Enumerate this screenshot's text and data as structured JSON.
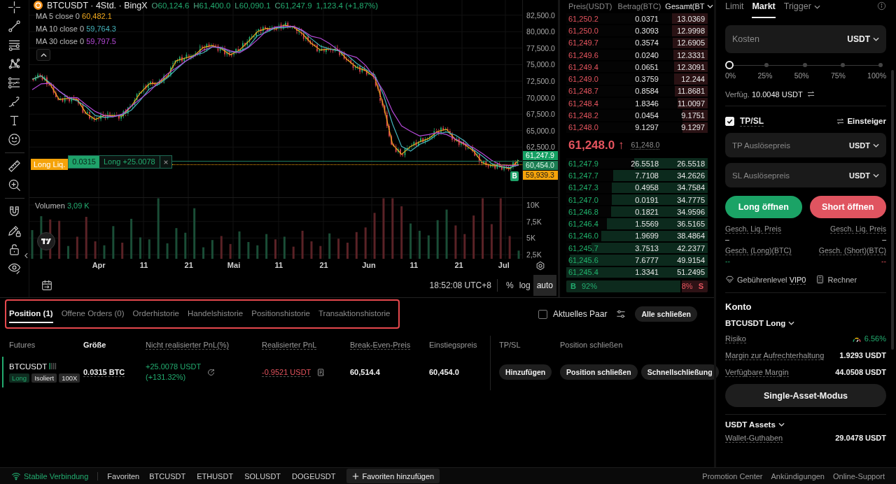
{
  "chart": {
    "title": "BTCUSDT · 4Std. · BingX",
    "ohlc": [
      {
        "label": "O",
        "value": "60,124.6"
      },
      {
        "label": "H",
        "value": "61,400.0"
      },
      {
        "label": "L",
        "value": "60,090.1"
      },
      {
        "label": "C",
        "value": "61,247.9"
      }
    ],
    "change": "1,123.4 (+1,87%)",
    "indicators": [
      {
        "label": "MA 5 close 0",
        "value": "60,482.1"
      },
      {
        "label": "MA 10 close 0",
        "value": "59,764.3"
      },
      {
        "label": "MA 30 close 0",
        "value": "59,797.5"
      }
    ],
    "chart_data": {
      "type": "line",
      "grid": true,
      "ylim": [
        54900,
        84800
      ],
      "yticks": [
        {
          "value": 62500,
          "label": "62,500.0"
        },
        {
          "value": 65000,
          "label": "65,000.0"
        },
        {
          "value": 67500,
          "label": "67,500.0"
        },
        {
          "value": 70000,
          "label": "70,000.0"
        },
        {
          "value": 72500,
          "label": "72,500.0"
        },
        {
          "value": 75000,
          "label": "75,000.0"
        },
        {
          "value": 77500,
          "label": "77,500.0"
        },
        {
          "value": 80000,
          "label": "80,000.0"
        },
        {
          "value": 82500,
          "label": "82,500.0"
        }
      ],
      "series": [
        {
          "color": "#f0a81c",
          "values": [
            72800,
            73300,
            72000,
            69700,
            69900,
            69700,
            67600,
            66700,
            67300,
            67300,
            67200,
            68700,
            70700,
            72100,
            72200,
            73200,
            75600,
            76000,
            76400,
            77600,
            77900,
            77400,
            76500,
            77200,
            78500,
            80000,
            80500,
            80400,
            81000,
            80700,
            79700,
            78200,
            77200,
            77400,
            77200,
            75700,
            74600,
            74100,
            73100,
            68800,
            62900,
            61400,
            62600,
            63300,
            63800,
            64900,
            65200,
            63600,
            62900,
            61900,
            60100,
            59700,
            59600,
            59200,
            60500
          ]
        },
        {
          "color": "#45b5bd",
          "values": [
            72800,
            73300,
            72200,
            71000,
            70000,
            69500,
            68600,
            67300,
            67000,
            67100,
            67400,
            68100,
            69600,
            71300,
            72000,
            73000,
            74300,
            75500,
            76400,
            76800,
            77700,
            77500,
            76900,
            77000,
            77700,
            79400,
            79900,
            80600,
            80600,
            80800,
            80100,
            78900,
            77800,
            77400,
            77100,
            76400,
            75200,
            74300,
            73500,
            70400,
            66000,
            62600,
            61900,
            62900,
            63500,
            64500,
            64800,
            64300,
            63400,
            62100,
            61100,
            60000,
            59500,
            59400,
            59800
          ]
        },
        {
          "color": "#b549d8",
          "values": [
            71200,
            72100,
            72200,
            71000,
            70000,
            70000,
            68900,
            67900,
            67300,
            67100,
            67500,
            68700,
            69800,
            70900,
            72300,
            73600,
            74500,
            75500,
            76300,
            77200,
            77700,
            77600,
            77100,
            76800,
            77600,
            78800,
            80100,
            80700,
            80800,
            80800,
            80200,
            79300,
            79000,
            78200,
            77200,
            76500,
            76100,
            74900,
            73100,
            71000,
            67900,
            65700,
            64900,
            64200,
            64400,
            64700,
            64400,
            63700,
            63000,
            62400,
            61500,
            60500,
            59800,
            59700,
            59800
          ]
        }
      ]
    },
    "price_tags": [
      {
        "kind": "last",
        "text": "61,247.9"
      },
      {
        "kind": "entry",
        "text": "60,454.0"
      },
      {
        "kind": "liquidation",
        "text": "59,939.3"
      }
    ],
    "liquidation_label": "Long Liq.",
    "position_line": {
      "quantity": "0.0315",
      "label": "Long +25.0078"
    },
    "trade_marker": "B",
    "volume": {
      "label": "Volumen",
      "value": "3,09 K",
      "chart_data": {
        "type": "bar",
        "grid": true,
        "ylim": [
          1867,
          11056
        ],
        "yticks": [
          {
            "value": 2500,
            "label": "2,5K"
          },
          {
            "value": 5000,
            "label": "5K"
          },
          {
            "value": 7500,
            "label": "7,5K"
          },
          {
            "value": 10000,
            "label": "10K"
          }
        ],
        "values": [
          6200,
          8300,
          7800,
          7600,
          3800,
          5200,
          8200,
          4500,
          3900,
          6800,
          4300,
          7900,
          5100,
          4800,
          11000,
          4200,
          6500,
          5800,
          9500,
          3600,
          4700,
          5300,
          4100,
          6000,
          4400,
          3900,
          5600,
          4800,
          5200,
          3700,
          6100,
          4500,
          3800,
          5700,
          4900,
          4300,
          5900,
          6600,
          8800,
          11000,
          11000,
          9800,
          7200,
          6100,
          5400,
          7700,
          9300,
          6900,
          5600,
          8400,
          11000,
          7100,
          11000,
          5300,
          3100
        ]
      }
    },
    "time_axis": [
      "Apr",
      "11",
      "21",
      "Mai",
      "11",
      "21",
      "Jun",
      "11",
      "21",
      "Jul"
    ],
    "time": "18:52:08 UTC+8",
    "scale_buttons": [
      {
        "label": "%",
        "selected": false
      },
      {
        "label": "log",
        "selected": false
      },
      {
        "label": "auto",
        "selected": true
      }
    ]
  },
  "order_book": {
    "columns": [
      {
        "label": "Preis(USDT)",
        "menu": false
      },
      {
        "label": "Betrag(BTC)",
        "menu": false
      },
      {
        "label": "Gesamt(BT",
        "menu": true
      }
    ],
    "asks": [
      {
        "price": "61,250.2",
        "amount": "0.0371",
        "total": "13.0369",
        "level": 0.254
      },
      {
        "price": "61,250.0",
        "amount": "0.3093",
        "total": "12.9998",
        "level": 0.254
      },
      {
        "price": "61,249.7",
        "amount": "0.3574",
        "total": "12.6905",
        "level": 0.248
      },
      {
        "price": "61,249.6",
        "amount": "0.0240",
        "total": "12.3331",
        "level": 0.241
      },
      {
        "price": "61,249.4",
        "amount": "0.0651",
        "total": "12.3091",
        "level": 0.24
      },
      {
        "price": "61,249.0",
        "amount": "0.3759",
        "total": "12.244",
        "level": 0.239
      },
      {
        "price": "61,248.7",
        "amount": "0.8584",
        "total": "11.8681",
        "level": 0.232
      },
      {
        "price": "61,248.4",
        "amount": "1.8346",
        "total": "11.0097",
        "level": 0.215
      },
      {
        "price": "61,248.2",
        "amount": "0.0454",
        "total": "9.1751",
        "level": 0.179
      },
      {
        "price": "61,248.0",
        "amount": "9.1297",
        "total": "9.1297",
        "level": 0.178
      }
    ],
    "last_price": "61,248.0 ↑",
    "last_trade_sell": true,
    "mark_price": "61,248.0",
    "bids": [
      {
        "price": "61,247.9",
        "amount": "26.5518",
        "total": "26.5518",
        "level": 0.518
      },
      {
        "price": "61,247.7",
        "amount": "7.7108",
        "total": "34.2626",
        "level": 0.669
      },
      {
        "price": "61,247.3",
        "amount": "0.4958",
        "total": "34.7584",
        "level": 0.678
      },
      {
        "price": "61,247.0",
        "amount": "0.0191",
        "total": "34.7775",
        "level": 0.679
      },
      {
        "price": "61,246.8",
        "amount": "0.1821",
        "total": "34.9596",
        "level": 0.682
      },
      {
        "price": "61,246.4",
        "amount": "1.5569",
        "total": "36.5165",
        "level": 0.713
      },
      {
        "price": "61,246.0",
        "amount": "1.9699",
        "total": "38.4864",
        "level": 0.751
      },
      {
        "price": "61,245.7",
        "amount": "3.7513",
        "total": "42.2377",
        "level": 0.824
      },
      {
        "price": "61,245.6",
        "amount": "7.6777",
        "total": "49.9154",
        "level": 0.974
      },
      {
        "price": "61,245.4",
        "amount": "1.3341",
        "total": "51.2495",
        "level": 1.0
      }
    ],
    "ratio": {
      "buy_label": "B",
      "buy_share": "92%",
      "sell_share": "8%",
      "sell_label": "S",
      "level": 0.86
    }
  },
  "order_form": {
    "tabs": [
      {
        "label": "Limit",
        "selected": false,
        "menu": false
      },
      {
        "label": "Markt",
        "selected": true,
        "menu": false
      },
      {
        "label": "Trigger",
        "selected": false,
        "menu": true
      }
    ],
    "cost_field": {
      "placeholder": "Kosten",
      "unit": "USDT"
    },
    "slider": {
      "level": 0,
      "marks": [
        "0%",
        "25%",
        "50%",
        "75%",
        "100%"
      ]
    },
    "available": {
      "label": "Verfüg.",
      "value": "10.0048 USDT"
    },
    "tpsl": {
      "label": "TP/SL",
      "checked": true,
      "mode": "Einsteiger"
    },
    "tp_field": {
      "placeholder": "TP Auslösepreis",
      "unit": "USDT"
    },
    "sl_field": {
      "placeholder": "SL Auslösepreis",
      "unit": "USDT"
    },
    "buttons": [
      {
        "kind": "long",
        "label": "Long öffnen"
      },
      {
        "kind": "short",
        "label": "Short öffnen"
      }
    ],
    "estimates": [
      {
        "label": "Gesch. Liq. Preis",
        "value": "–",
        "kind": "neutral"
      },
      {
        "label": "Gesch. Liq. Preis",
        "value": "–",
        "kind": "neutral"
      },
      {
        "label": "Gesch. (Long)(BTC)",
        "value": "--",
        "kind": "long"
      },
      {
        "label": "Gesch. (Short)(BTC)",
        "value": "--",
        "kind": "short"
      }
    ],
    "fee_level": {
      "label": "Gebührenlevel",
      "value": "VIP0"
    },
    "calculator": "Rechner"
  },
  "account": {
    "title": "Konto",
    "position": "BTCUSDT Long",
    "rows": [
      {
        "label": "Risiko",
        "value": "6.56%",
        "kind": "risk"
      },
      {
        "label": "Margin zur Aufrechterhaltung",
        "value": "1.9293 USDT",
        "kind": "plain"
      },
      {
        "label": "Verfügbare Margin",
        "value": "44.0508 USDT",
        "kind": "plain"
      }
    ],
    "mode_button": "Single-Asset-Modus",
    "assets_title": "USDT Assets",
    "wallet": {
      "label": "Wallet-Guthaben",
      "value": "29.0478 USDT"
    }
  },
  "positions": {
    "highlighted": true,
    "tabs": [
      {
        "label": "Position (1)",
        "selected": true
      },
      {
        "label": "Offene Orders (0)",
        "selected": false
      },
      {
        "label": "Orderhistorie",
        "selected": false
      },
      {
        "label": "Handelshistorie",
        "selected": false
      },
      {
        "label": "Positionshistorie",
        "selected": false
      },
      {
        "label": "Transaktionshistorie",
        "selected": false
      }
    ],
    "current_pair": {
      "label": "Aktuelles Paar",
      "checked": false
    },
    "close_all": "Alle schließen",
    "columns": [
      {
        "label": "Futures",
        "has_tooltip": false
      },
      {
        "label": "Größe",
        "has_tooltip": false
      },
      {
        "label": "Nicht realisierter PnL(%)",
        "has_tooltip": true
      },
      {
        "label": "Realisierter PnL",
        "has_tooltip": true
      },
      {
        "label": "Break-Even-Preis",
        "has_tooltip": true
      },
      {
        "label": "Einstiegspreis",
        "has_tooltip": false
      },
      {
        "label": "TP/SL",
        "has_tooltip": false
      },
      {
        "label": "Position schließen",
        "has_tooltip": false
      }
    ],
    "rows": [
      {
        "kind": "long",
        "symbol": "BTCUSDT",
        "tags": [
          {
            "kind": "side",
            "text": "Long"
          },
          {
            "kind": "plain",
            "text": "Isoliert"
          },
          {
            "kind": "plain",
            "text": "100X"
          }
        ],
        "size": "0.0315 BTC",
        "unrealized_pnl": "+25.0078 USDT",
        "unrealized_pct": "(+131.32%)",
        "unrealized_gain": true,
        "realized_pnl": "-0.9521 USDT",
        "realized_gain": false,
        "break_even": "60,514.4",
        "entry": "60,454.0",
        "tpsl_action": "Hinzufügen",
        "close_actions": [
          "Position schließen",
          "Schnellschließung"
        ]
      }
    ]
  },
  "status_bar": {
    "connected": true,
    "connection": "Stabile Verbindung",
    "favorites_label": "Favoriten",
    "favorites": [
      "BTCUSDT",
      "ETHUSDT",
      "SOLUSDT",
      "DOGEUSDT"
    ],
    "add_favorite": "Favoriten hinzufügen",
    "links": [
      "Promotion Center",
      "Ankündigungen",
      "Online-Support"
    ]
  }
}
